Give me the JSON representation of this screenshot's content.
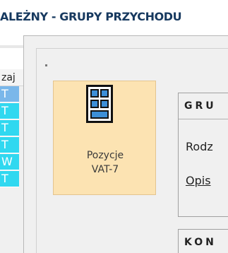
{
  "window": {
    "title": "ALEŻNY - GRUPY PRZYCHODU"
  },
  "grid": {
    "column_header": "zaj",
    "rows": [
      {
        "value": "T",
        "color": "#7ab7ea"
      },
      {
        "value": "T",
        "color": "#30d8f0"
      },
      {
        "value": "T",
        "color": "#30d8f0"
      },
      {
        "value": "T",
        "color": "#30d8f0"
      },
      {
        "value": "W",
        "color": "#30d8f0"
      },
      {
        "value": "T",
        "color": "#30d8f0"
      }
    ]
  },
  "tile": {
    "label_line1": "Pozycje",
    "label_line2": "VAT-7",
    "icon": "vat-document-icon",
    "background": "#fce3b2"
  },
  "group": {
    "title": "GRU",
    "field1_label": "Rodz",
    "field2_label": "Opis"
  },
  "group2": {
    "title": "KON"
  }
}
